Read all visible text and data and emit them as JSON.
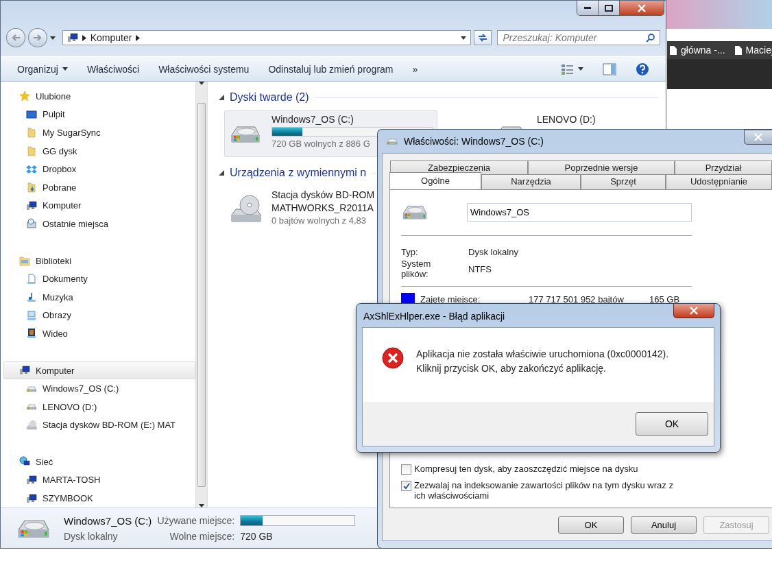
{
  "desktop": {
    "browser_tabs": [
      {
        "label": "główna -...",
        "kind": "page"
      },
      {
        "label": "Maciej",
        "kind": "page"
      }
    ]
  },
  "explorer": {
    "address": {
      "path": [
        "Komputer"
      ],
      "search_placeholder": "Przeszukaj: Komputer"
    },
    "toolbar": [
      {
        "label": "Organizuj",
        "kind": "menu"
      },
      {
        "label": "Właściwości",
        "kind": "button"
      },
      {
        "label": "Właściwości systemu",
        "kind": "button"
      },
      {
        "label": "Odinstaluj lub zmień program",
        "kind": "button"
      },
      {
        "label": "»",
        "kind": "button"
      }
    ],
    "nav": [
      {
        "label": "Ulubione",
        "kind": "star",
        "selected": false,
        "children": [
          {
            "label": "Pulpit",
            "kind": "desktop",
            "selected": false
          },
          {
            "label": "My SugarSync",
            "kind": "folder",
            "selected": false
          },
          {
            "label": "GG dysk",
            "kind": "folder",
            "selected": false
          },
          {
            "label": "Dropbox",
            "kind": "box",
            "selected": false
          },
          {
            "label": "Pobrane",
            "kind": "download",
            "selected": false
          },
          {
            "label": "Komputer",
            "kind": "computer",
            "selected": false
          },
          {
            "label": "Ostatnie miejsca",
            "kind": "recent",
            "selected": false
          }
        ]
      },
      {
        "label": "Biblioteki",
        "kind": "library",
        "selected": false,
        "children": [
          {
            "label": "Dokumenty",
            "kind": "document",
            "selected": false
          },
          {
            "label": "Muzyka",
            "kind": "music",
            "selected": false
          },
          {
            "label": "Obrazy",
            "kind": "picture",
            "selected": false
          },
          {
            "label": "Wideo",
            "kind": "video",
            "selected": false
          }
        ]
      },
      {
        "label": "Komputer",
        "kind": "computer",
        "selected": true,
        "children": [
          {
            "label": "Windows7_OS (C:)",
            "kind": "drive",
            "selected": false
          },
          {
            "label": "LENOVO (D:)",
            "kind": "drive",
            "selected": false
          },
          {
            "label": "Stacja dysków BD-ROM (E:) MAT",
            "kind": "disc",
            "selected": false
          }
        ]
      },
      {
        "label": "Sieć",
        "kind": "network",
        "selected": false,
        "children": [
          {
            "label": "MARTA-TOSH",
            "kind": "computer",
            "selected": false
          },
          {
            "label": "SZYMBOOK",
            "kind": "computer",
            "selected": false
          }
        ]
      }
    ],
    "groups": [
      {
        "title": "Dyski twarde (2)",
        "items": [
          {
            "name": "Windows7_OS (C:)",
            "kind": "drive",
            "selected": true,
            "level": 0.19,
            "free": "720 GB wolnych z 886 G"
          },
          {
            "name": "LENOVO (D:)",
            "kind": "plain",
            "selected": false
          }
        ]
      },
      {
        "title": "Urządzenia z wymiennymi n",
        "items": [
          {
            "name": "Stacja dysków BD-ROM",
            "label": "MATHWORKS_R2011A",
            "kind": "disc",
            "selected": false,
            "free": "0 bajtów wolnych z 4,83"
          }
        ]
      }
    ],
    "details": {
      "name": "Windows7_OS (C:)",
      "type": "Dysk lokalny",
      "used_label": "Używane miejsce:",
      "level": 0.19,
      "free_label": "Wolne miejsce:",
      "free": "720 GB"
    }
  },
  "properties": {
    "title": "Właściwości: Windows7_OS (C:)",
    "tabs_back": [
      {
        "label": "Zabezpieczenia",
        "selected": false
      },
      {
        "label": "Poprzednie wersje",
        "selected": false
      },
      {
        "label": "Przydział",
        "selected": false
      }
    ],
    "tabs_front": [
      {
        "label": "Ogólne",
        "selected": true
      },
      {
        "label": "Narzędzia",
        "selected": false
      },
      {
        "label": "Sprzęt",
        "selected": false
      },
      {
        "label": "Udostępnianie",
        "selected": false
      }
    ],
    "name_value": "Windows7_OS",
    "info": [
      {
        "label": "Typ:",
        "value": "Dysk lokalny"
      },
      {
        "label": "System plików:",
        "value": "NTFS"
      }
    ],
    "used": {
      "label": "Zajęte miejsce:",
      "bytes": "177 717 501 952 bajtów",
      "size": "165 GB",
      "color": "#0000ff"
    },
    "options": [
      {
        "label": "Kompresuj ten dysk, aby zaoszczędzić miejsce na dysku",
        "checked": false
      },
      {
        "label": "Zezwalaj na indeksowanie zawartości plików na tym dysku wraz z ich właściwościami",
        "checked": true
      }
    ],
    "buttons": [
      {
        "label": "OK",
        "disabled": false
      },
      {
        "label": "Anuluj",
        "disabled": false
      },
      {
        "label": "Zastosuj",
        "disabled": true
      }
    ]
  },
  "error": {
    "title": "AxShlExHlper.exe - Błąd aplikacji",
    "message": [
      "Aplikacja nie została właściwie uruchomiona (0xc0000142).",
      "Kliknij przycisk OK, aby zakończyć aplikację."
    ],
    "button": "OK"
  }
}
